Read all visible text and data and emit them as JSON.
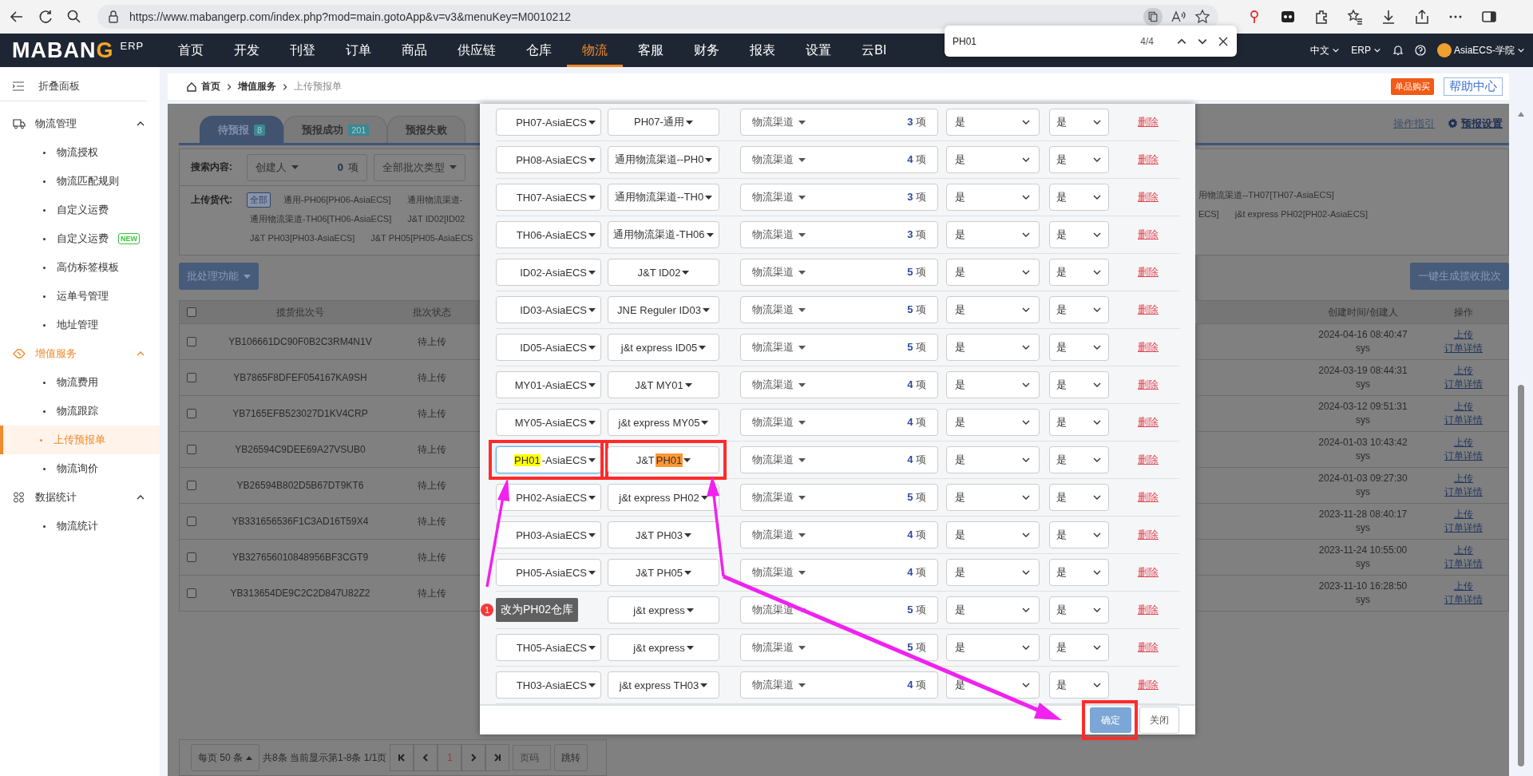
{
  "browser": {
    "url": "https://www.mabangerp.com/index.php?mod=main.gotoApp&v=v3&menuKey=M0010212"
  },
  "find_bar": {
    "query": "PH01",
    "count": "4/4"
  },
  "nav": {
    "logo": [
      {
        "text": "MABAN",
        "accent": false
      },
      {
        "text": "G",
        "accent": true
      }
    ],
    "logo_suffix": "ERP",
    "menu": [
      {
        "label": "首页",
        "selected": false
      },
      {
        "label": "开发",
        "selected": false
      },
      {
        "label": "刊登",
        "selected": false
      },
      {
        "label": "订单",
        "selected": false
      },
      {
        "label": "商品",
        "selected": false
      },
      {
        "label": "供应链",
        "selected": false
      },
      {
        "label": "仓库",
        "selected": false
      },
      {
        "label": "物流",
        "selected": true
      },
      {
        "label": "客服",
        "selected": false
      },
      {
        "label": "财务",
        "selected": false
      },
      {
        "label": "报表",
        "selected": false
      },
      {
        "label": "设置",
        "selected": false
      },
      {
        "label": "云BI",
        "selected": false
      }
    ],
    "language": "中文",
    "erp": "ERP",
    "user": "AsiaECS-学院"
  },
  "sidebar": {
    "collapse_label": "折叠面板",
    "groups": [
      {
        "label": "物流管理",
        "kind": "truck",
        "active": false,
        "expanded": true,
        "items": [
          {
            "label": "物流授权",
            "selected": false
          },
          {
            "label": "物流匹配规则",
            "selected": false
          },
          {
            "label": "自定义运费",
            "selected": false
          },
          {
            "label": "自定义运费",
            "badge": "NEW",
            "selected": false
          },
          {
            "label": "高仿标签模板",
            "selected": false
          },
          {
            "label": "运单号管理",
            "selected": false
          },
          {
            "label": "地址管理",
            "selected": false
          }
        ]
      },
      {
        "label": "增值服务",
        "kind": "tag",
        "active": true,
        "expanded": true,
        "items": [
          {
            "label": "物流费用",
            "selected": false
          },
          {
            "label": "物流跟踪",
            "selected": false
          },
          {
            "label": "上传预报单",
            "selected": true
          },
          {
            "label": "物流询价",
            "selected": false
          }
        ]
      },
      {
        "label": "数据统计",
        "kind": "grid",
        "active": false,
        "expanded": true,
        "items": [
          {
            "label": "物流统计",
            "selected": false
          }
        ]
      }
    ]
  },
  "breadcrumb": [
    "首页",
    "增值服务",
    "上传预报单"
  ],
  "header_buttons": {
    "buy": "单品购买",
    "help": "帮助中心"
  },
  "background": {
    "tabs": [
      {
        "label": "待预报",
        "count": "8",
        "selected": true
      },
      {
        "label": "预报成功",
        "count": "201",
        "selected": false
      },
      {
        "label": "预报失败",
        "selected": false
      }
    ],
    "guide_link": "操作指引",
    "settings_link": "预报设置",
    "search_label": "搜索内容:",
    "creator_select": "创建人",
    "creator_count": "0",
    "count_unit": "项",
    "batch_type_select": "全部批次类型",
    "forwarder_label": "上传货代:",
    "forwarder_tags_left": [
      [
        {
          "label": "全部",
          "selected": true
        },
        {
          "label": "通用-PH06[PH06-AsiaECS]",
          "selected": false
        },
        {
          "label": "通用物流渠道-",
          "selected": false
        }
      ],
      [
        {
          "label": "通用物流渠道-TH06[TH06-AsiaECS]",
          "selected": false
        },
        {
          "label": "J&T ID02[ID02",
          "selected": false
        }
      ],
      [
        {
          "label": "J&T PH03[PH03-AsiaECS]",
          "selected": false
        },
        {
          "label": "J&T PH05[PH05-AsiaECS",
          "selected": false
        }
      ]
    ],
    "forwarder_tags_right": [
      [
        {
          "label": "用物流渠道--TH07[TH07-AsiaECS]",
          "selected": false
        }
      ],
      [
        {
          "label": "ECS]",
          "selected": false
        },
        {
          "label": "j&t express PH02[PH02-AsiaECS]",
          "selected": false
        }
      ]
    ],
    "batch_button": "批处理功能",
    "generate_button": "一键生成揽收批次",
    "table": {
      "select_all_checked": false,
      "columns_left": [
        "揽货批次号",
        "批次状态"
      ],
      "columns_right": [
        "创建时间/创建人",
        "操作"
      ],
      "rows": [
        {
          "checked": false,
          "batch_no": "YB106661DC90F0B2C3RM4N1V",
          "status": "待上传",
          "created": "2024-04-16 08:40:47",
          "creator": "sys",
          "actions": [
            "上传",
            "订单详情"
          ]
        },
        {
          "checked": false,
          "batch_no": "YB7865F8DFEF054167KA9SH",
          "status": "待上传",
          "created": "2024-03-19 08:44:31",
          "creator": "sys",
          "actions": [
            "上传",
            "订单详情"
          ]
        },
        {
          "checked": false,
          "batch_no": "YB7165EFB523027D1KV4CRP",
          "status": "待上传",
          "created": "2024-03-12 09:51:31",
          "creator": "sys",
          "actions": [
            "上传",
            "订单详情"
          ]
        },
        {
          "checked": false,
          "batch_no": "YB26594C9DEE69A27VSUB0",
          "status": "待上传",
          "created": "2024-01-03 10:43:42",
          "creator": "sys",
          "actions": [
            "上传",
            "订单详情"
          ]
        },
        {
          "checked": false,
          "batch_no": "YB26594B802D5B67DT9KT6",
          "status": "待上传",
          "created": "2024-01-03 09:27:30",
          "creator": "sys",
          "actions": [
            "上传",
            "订单详情"
          ]
        },
        {
          "checked": false,
          "batch_no": "YB331656536F1C3AD16T59X4",
          "status": "待上传",
          "created": "2023-11-28 08:40:17",
          "creator": "sys",
          "actions": [
            "上传",
            "订单详情"
          ]
        },
        {
          "checked": false,
          "batch_no": "YB327656010848956BF3CGT9",
          "status": "待上传",
          "created": "2023-11-24 10:55:00",
          "creator": "sys",
          "actions": [
            "上传",
            "订单详情"
          ]
        },
        {
          "checked": false,
          "batch_no": "YB313654DE9C2C2D847U82Z2",
          "status": "待上传",
          "created": "2023-11-10 16:28:50",
          "creator": "sys",
          "actions": [
            "上传",
            "订单详情"
          ]
        }
      ]
    },
    "pagination": {
      "page_size": "每页 50 条",
      "summary": "共8条 当前显示第1-8条 1/1页",
      "page": "1",
      "page_placeholder": "页码",
      "jump": "跳转"
    }
  },
  "modal": {
    "rows": [
      {
        "warehouse": "PH07-AsiaECS",
        "channel": "PH07-通用",
        "channel_type": "物流渠道",
        "count": "3",
        "unit": "项",
        "option_1": "是",
        "option_2": "是",
        "delete": "删除"
      },
      {
        "warehouse": "PH08-AsiaECS",
        "channel": "通用物流渠道--PH0",
        "channel_type": "物流渠道",
        "count": "4",
        "unit": "项",
        "option_1": "是",
        "option_2": "是",
        "delete": "删除"
      },
      {
        "warehouse": "TH07-AsiaECS",
        "channel": "通用物流渠道--TH0",
        "channel_type": "物流渠道",
        "count": "3",
        "unit": "项",
        "option_1": "是",
        "option_2": "是",
        "delete": "删除"
      },
      {
        "warehouse": "TH06-AsiaECS",
        "channel": "通用物流渠道-TH06",
        "channel_type": "物流渠道",
        "count": "3",
        "unit": "项",
        "option_1": "是",
        "option_2": "是",
        "delete": "删除"
      },
      {
        "warehouse": "ID02-AsiaECS",
        "channel": "J&T ID02",
        "channel_type": "物流渠道",
        "count": "5",
        "unit": "项",
        "option_1": "是",
        "option_2": "是",
        "delete": "删除"
      },
      {
        "warehouse": "ID03-AsiaECS",
        "channel": "JNE Reguler ID03",
        "channel_type": "物流渠道",
        "count": "5",
        "unit": "项",
        "option_1": "是",
        "option_2": "是",
        "delete": "删除"
      },
      {
        "warehouse": "ID05-AsiaECS",
        "channel": "j&t express ID05",
        "channel_type": "物流渠道",
        "count": "5",
        "unit": "项",
        "option_1": "是",
        "option_2": "是",
        "delete": "删除"
      },
      {
        "warehouse": "MY01-AsiaECS",
        "channel": "J&T MY01",
        "channel_type": "物流渠道",
        "count": "4",
        "unit": "项",
        "option_1": "是",
        "option_2": "是",
        "delete": "删除"
      },
      {
        "warehouse": "MY05-AsiaECS",
        "channel": "j&t express MY05",
        "channel_type": "物流渠道",
        "count": "4",
        "unit": "项",
        "option_1": "是",
        "option_2": "是",
        "delete": "删除"
      },
      {
        "warehouse": [
          {
            "text": "PH01",
            "highlighted": true,
            "current": false
          },
          {
            "text": "-AsiaECS",
            "highlighted": false,
            "current": false
          }
        ],
        "warehouse_focused": true,
        "warehouse_framed": true,
        "channel": [
          {
            "text": "J&T ",
            "highlighted": false,
            "current": false
          },
          {
            "text": "PH01",
            "highlighted": true,
            "current": true
          }
        ],
        "channel_framed": true,
        "channel_type": "物流渠道",
        "count": "4",
        "unit": "项",
        "option_1": "是",
        "option_2": "是",
        "delete": "删除"
      },
      {
        "warehouse": "PH02-AsiaECS",
        "channel": "j&t express PH02",
        "channel_type": "物流渠道",
        "count": "5",
        "unit": "项",
        "option_1": "是",
        "option_2": "是",
        "delete": "删除"
      },
      {
        "warehouse": "PH03-AsiaECS",
        "channel": "J&T PH03",
        "channel_type": "物流渠道",
        "count": "4",
        "unit": "项",
        "option_1": "是",
        "option_2": "是",
        "delete": "删除"
      },
      {
        "warehouse": "PH05-AsiaECS",
        "channel": "J&T PH05",
        "channel_type": "物流渠道",
        "count": "4",
        "unit": "项",
        "option_1": "是",
        "option_2": "是",
        "delete": "删除"
      },
      {
        "callout": {
          "badge": "1",
          "text": "改为PH02仓库"
        },
        "channel": "j&t express",
        "channel_type": "物流渠道",
        "count": "5",
        "unit": "项",
        "option_1": "是",
        "option_2": "是",
        "delete": "删除"
      },
      {
        "warehouse": "TH05-AsiaECS",
        "channel": "j&t express",
        "channel_type": "物流渠道",
        "count": "5",
        "unit": "项",
        "option_1": "是",
        "option_2": "是",
        "delete": "删除"
      },
      {
        "warehouse": "TH03-AsiaECS",
        "channel": "j&t express TH03",
        "channel_type": "物流渠道",
        "count": "4",
        "unit": "项",
        "option_1": "是",
        "option_2": "是",
        "delete": "删除"
      }
    ],
    "confirm": "确定",
    "confirm_framed": true,
    "close": "关闭"
  }
}
